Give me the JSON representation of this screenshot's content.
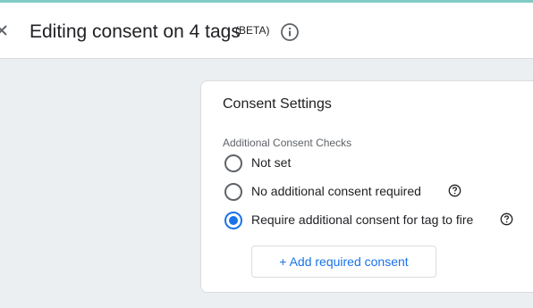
{
  "header": {
    "title": "Editing consent on 4 tags",
    "badge": "(BETA)",
    "close_icon": "close-icon",
    "info_icon": "info-icon"
  },
  "card": {
    "title": "Consent Settings",
    "section_label": "Additional Consent Checks",
    "options": [
      {
        "label": "Not set",
        "selected": false,
        "has_help": false
      },
      {
        "label": "No additional consent required",
        "selected": false,
        "has_help": true
      },
      {
        "label": "Require additional consent for tag to fire",
        "selected": true,
        "has_help": true
      }
    ],
    "add_button_label": "+ Add required consent"
  },
  "colors": {
    "accent": "#1a73e8",
    "top_bar": "#80cbc4",
    "background": "#eceff1",
    "radio_unselected": "#5f6368"
  }
}
